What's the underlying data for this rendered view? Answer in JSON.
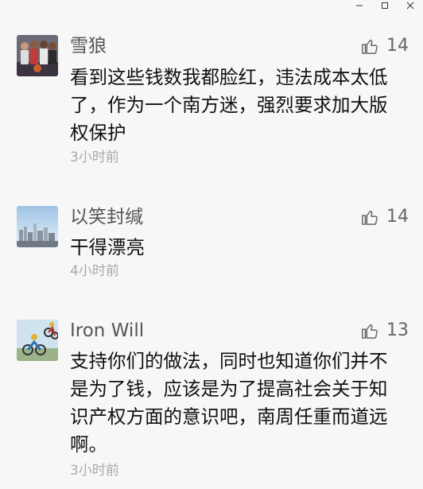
{
  "comments": [
    {
      "author": "雪狼",
      "likes": "14",
      "text": "看到这些钱数我都脸红，违法成本太低了，作为一个南方迷，强烈要求加大版权保护",
      "time": "3小时前"
    },
    {
      "author": "以笑封缄",
      "likes": "14",
      "text": "干得漂亮",
      "time": "4小时前"
    },
    {
      "author": "Iron Will",
      "likes": "13",
      "text": "支持你们的做法，同时也知道你们并不是为了钱，应该是为了提高社会关于知识产权方面的意识吧，南周任重而道远啊。",
      "time": "3小时前"
    }
  ],
  "icons": {
    "like": "thumbs-up-icon",
    "minimize": "minimize-icon",
    "maximize": "maximize-icon",
    "close": "close-icon"
  }
}
